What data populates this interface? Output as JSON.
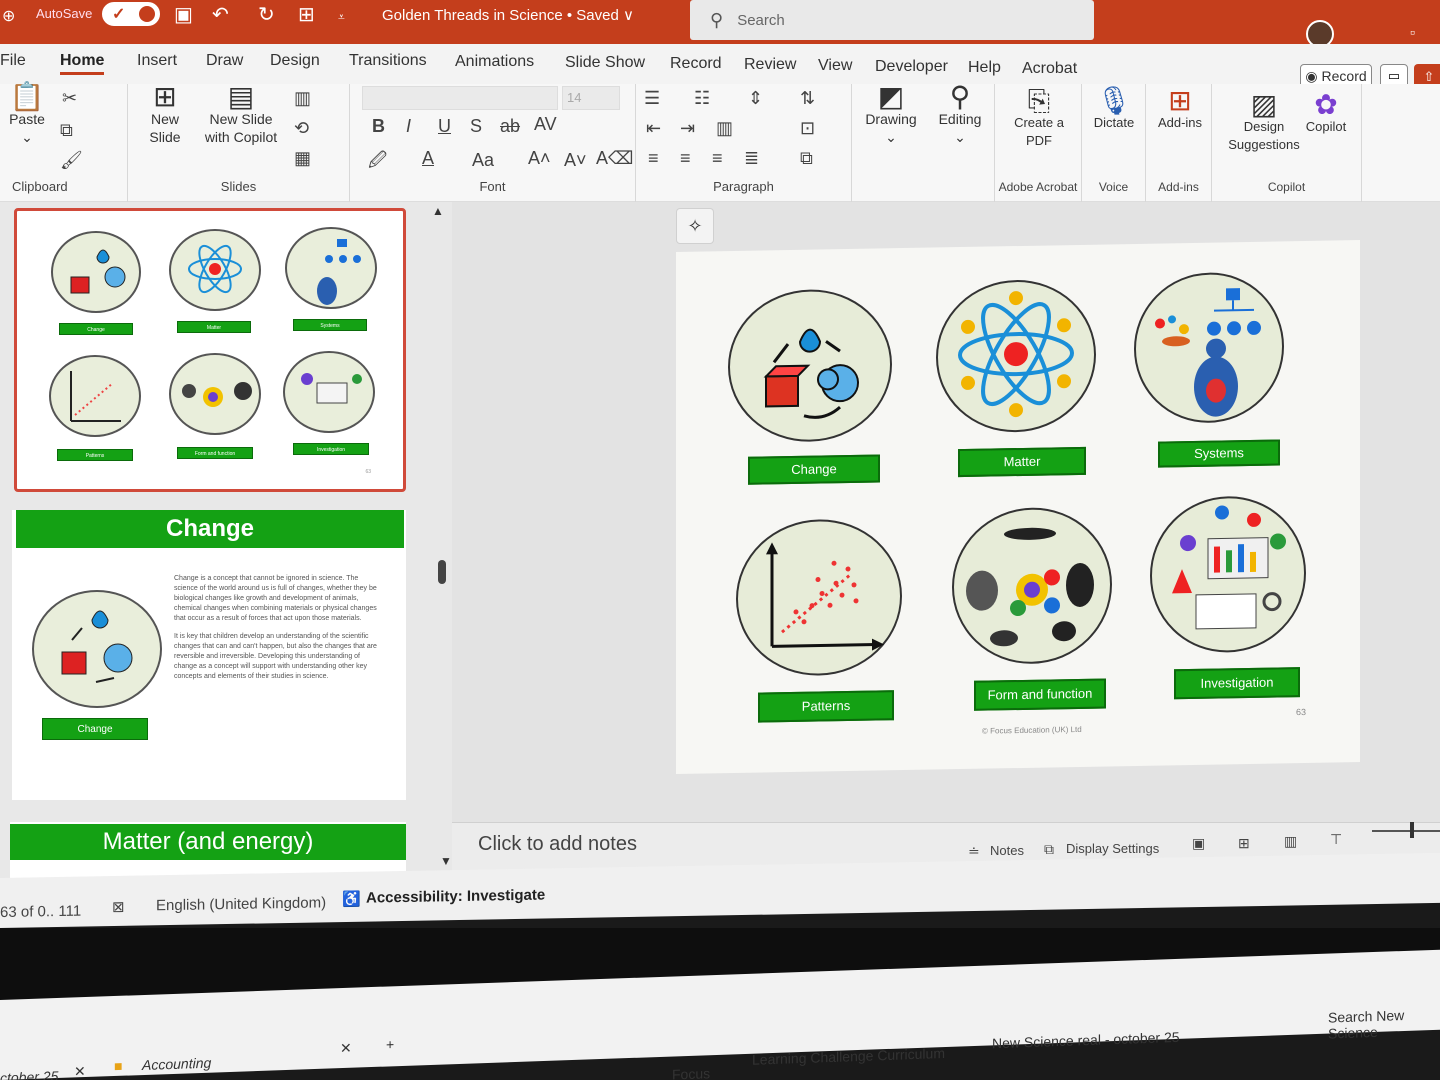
{
  "titlebar": {
    "autosave_label": "AutoSave",
    "doc_title": "Golden Threads in Science • Saved ∨",
    "search_placeholder": "Search"
  },
  "menu": {
    "tabs": [
      "File",
      "Home",
      "Insert",
      "Draw",
      "Design",
      "Transitions",
      "Animations",
      "Slide Show",
      "Record",
      "Review",
      "View",
      "Developer",
      "Help",
      "Acrobat"
    ],
    "record_label": "Record"
  },
  "ribbon": {
    "clipboard": {
      "paste": "Paste",
      "group": "Clipboard"
    },
    "slides": {
      "new_slide": "New Slide",
      "new_slide_copilot": "New Slide with Copilot",
      "group": "Slides"
    },
    "font": {
      "size": "14",
      "group": "Font"
    },
    "paragraph": {
      "group": "Paragraph"
    },
    "drawing": "Drawing",
    "editing": "Editing",
    "create_pdf": "Create a PDF",
    "adobe_group": "Adobe Acrobat",
    "dictate": "Dictate",
    "voice_group": "Voice",
    "addins": "Add-ins",
    "addins_group": "Add-ins",
    "design_suggestions": "Design Suggestions",
    "copilot": "Copilot",
    "copilot_group": "Copilot"
  },
  "thumbnails": {
    "slide2_title": "Change",
    "slide2_label": "Change",
    "slide2_para1": "Change is a concept that cannot be ignored in science. The science of the world around us is full of changes, whether they be biological changes like growth and development of animals, chemical changes when combining materials or physical changes that occur as a result of forces that act upon those materials.",
    "slide2_para2": "It is key that children develop an understanding of the scientific changes that can and can't happen, but also the changes that are reversible and irreversible. Developing this understanding of change as a concept will support with understanding other key concepts and elements of their studies in science.",
    "slide3_title": "Matter (and energy)"
  },
  "slide": {
    "labels": [
      "Change",
      "Matter",
      "Systems",
      "Patterns",
      "Form and function",
      "Investigation"
    ],
    "copyright": "© Focus Education (UK) Ltd",
    "number": "63"
  },
  "notes": {
    "placeholder": "Click to add notes",
    "notes_btn": "Notes",
    "display_settings": "Display Settings"
  },
  "status": {
    "slide_count": "63 of 0.. 111",
    "language": "English (United Kingdom)",
    "accessibility": "Accessibility: Investigate"
  },
  "taskbar": {
    "tab1": "ctober 25",
    "tab2": "Accounting",
    "crumb1": "Focus",
    "crumb2": "Learning Challenge Curriculum",
    "crumb3": "New Science real - october 25",
    "search": "Search New Science"
  },
  "colors": {
    "accent": "#c43e1c",
    "label_green": "#14a114"
  }
}
